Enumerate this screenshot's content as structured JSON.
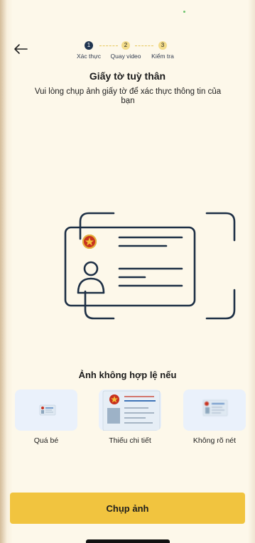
{
  "header": {
    "back_icon": "arrow-left-icon"
  },
  "stepper": {
    "steps": [
      {
        "number": "1",
        "label": "Xác thực",
        "state": "active"
      },
      {
        "number": "2",
        "label": "Quay video",
        "state": "inactive"
      },
      {
        "number": "3",
        "label": "Kiểm tra",
        "state": "inactive"
      }
    ]
  },
  "main": {
    "title": "Giấy tờ tuỳ thân",
    "subtitle": "Vui lòng chụp ảnh giấy tờ để xác thực thông tin của bạn"
  },
  "invalid_section": {
    "title": "Ảnh không hợp lệ nếu",
    "examples": [
      {
        "caption": "Quá bé"
      },
      {
        "caption": "Thiếu chi tiết"
      },
      {
        "caption": "Không rõ nét"
      }
    ]
  },
  "cta": {
    "label": "Chụp ảnh"
  },
  "colors": {
    "accent": "#f1c43f",
    "primary_dark": "#1f3450",
    "background": "#fdf8ea"
  }
}
